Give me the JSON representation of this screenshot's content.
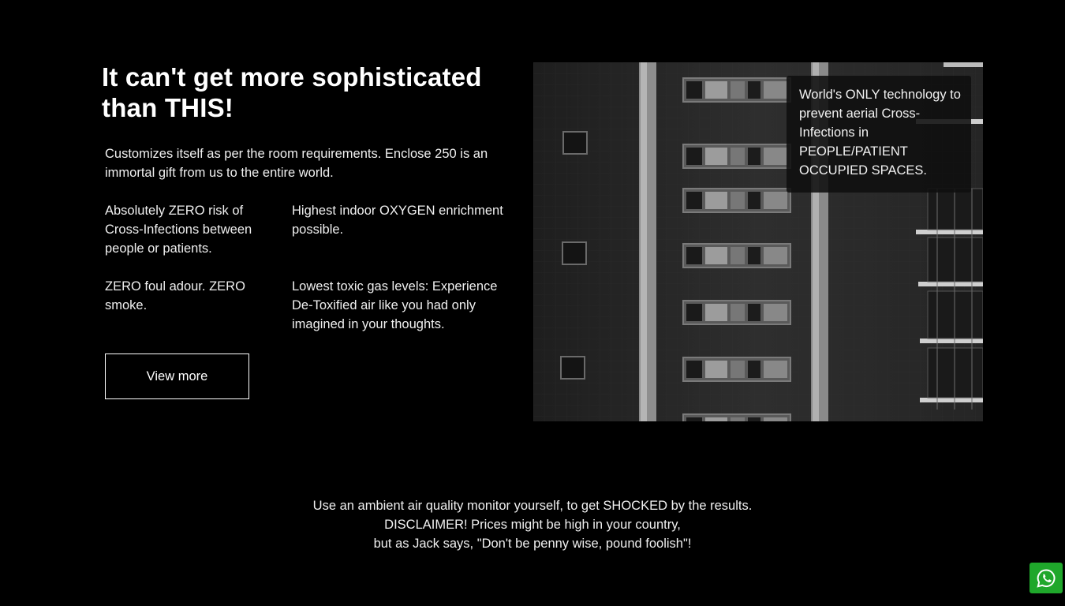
{
  "hero": {
    "heading": "It can't get more sophisticated than THIS!",
    "intro": "Customizes itself as per the room requirements. Enclose 250 is an immortal gift from us to the entire world.",
    "features": [
      "Absolutely ZERO risk of Cross-Infections between people or patients.",
      "Highest indoor OXYGEN enrichment possible.",
      "ZERO foul adour. ZERO smoke.",
      "Lowest toxic gas levels: Experience De-Toxified air like you had only imagined in your thoughts."
    ],
    "button_label": "View more"
  },
  "image_callout": "World's ONLY technology to prevent aerial Cross-Infections in PEOPLE/PATIENT OCCUPIED SPACES.",
  "footer": {
    "lines": [
      "Use an ambient air quality monitor yourself, to get SHOCKED by the results.",
      "DISCLAIMER! Prices might be high in your country,",
      "but as Jack says, \"Don't be penny wise, pound foolish\"!"
    ]
  },
  "icons": {
    "chat": "whatsapp-icon",
    "image": "building-facade-photo"
  },
  "colors": {
    "background": "#000000",
    "text": "#ffffff",
    "whatsapp": "#1fa72b"
  }
}
